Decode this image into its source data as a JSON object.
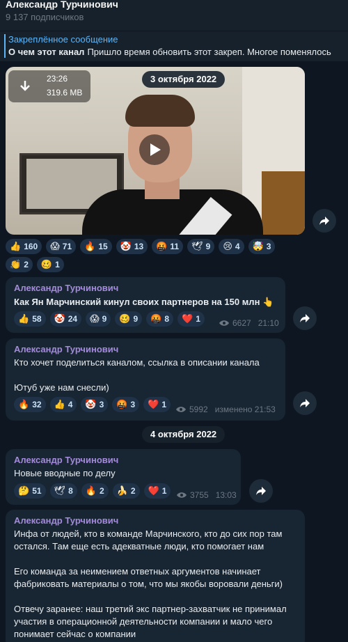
{
  "header": {
    "title": "Александр Турчинович",
    "subscribers": "9 137 подписчиков"
  },
  "pinned": {
    "label": "Закреплённое сообщение",
    "bold": "О чем этот канал",
    "text": "Пришло время обновить этот закреп. Многое поменялось"
  },
  "video": {
    "duration": "23:26",
    "size": "319.6 MB",
    "date": "3 октября 2022"
  },
  "video_reactions": [
    {
      "emoji": "👍",
      "count": "160"
    },
    {
      "emoji": "😱",
      "count": "71"
    },
    {
      "emoji": "🔥",
      "count": "15"
    },
    {
      "emoji": "🤡",
      "count": "13"
    },
    {
      "emoji": "🤬",
      "count": "11"
    },
    {
      "emoji": "🕊",
      "count": "9"
    },
    {
      "emoji": "😢",
      "count": "4"
    },
    {
      "emoji": "🤯",
      "count": "3"
    },
    {
      "emoji": "👏",
      "count": "2"
    },
    {
      "emoji": "🥴",
      "count": "1"
    }
  ],
  "messages": [
    {
      "author": "Александр Турчинович",
      "text": "Как Ян Марчинский кинул своих партнеров на 150 млн 👆",
      "reactions": [
        {
          "emoji": "👍",
          "count": "58"
        },
        {
          "emoji": "🤡",
          "count": "24"
        },
        {
          "emoji": "😱",
          "count": "9"
        },
        {
          "emoji": "🥴",
          "count": "9"
        },
        {
          "emoji": "🤬",
          "count": "8"
        },
        {
          "emoji": "❤️",
          "count": "1"
        }
      ],
      "views": "6627",
      "time": "21:10"
    },
    {
      "author": "Александр Турчинович",
      "text": "Кто хочет поделиться каналом, ссылка в описании канала\n\nЮтуб уже нам снесли)",
      "reactions": [
        {
          "emoji": "🔥",
          "count": "32"
        },
        {
          "emoji": "👍",
          "count": "4"
        },
        {
          "emoji": "🤡",
          "count": "3"
        },
        {
          "emoji": "🤬",
          "count": "3"
        },
        {
          "emoji": "❤️",
          "count": "1"
        }
      ],
      "views": "5992",
      "time": "изменено 21:53"
    },
    {
      "author": "Александр Турчинович",
      "text": "Новые вводные по делу",
      "reactions": [
        {
          "emoji": "🤔",
          "count": "51"
        },
        {
          "emoji": "🕊",
          "count": "8"
        },
        {
          "emoji": "🔥",
          "count": "2"
        },
        {
          "emoji": "🍌",
          "count": "2"
        },
        {
          "emoji": "❤️",
          "count": "1"
        }
      ],
      "views": "3755",
      "time": "13:03"
    },
    {
      "author": "Александр Турчинович",
      "text": "Инфа от людей, кто в команде Марчинского, кто до сих пор там остался. Там еще есть адекватные люди, кто помогает нам\n\nЕго команда за неимением ответных аргументов начинает фабриковать материалы о том, что мы якобы воровали деньги)\n\nОтвечу заранее: наш третий экс партнер-захватчик не принимал участия в операционной деятельности компании и мало чего понимает сейчас о компании"
    }
  ],
  "date_separator_2": "4 октября 2022",
  "colors": {
    "background": "#0e1621",
    "bubble": "#182533",
    "author": "#a48bdc",
    "accent": "#5eb5f7"
  }
}
